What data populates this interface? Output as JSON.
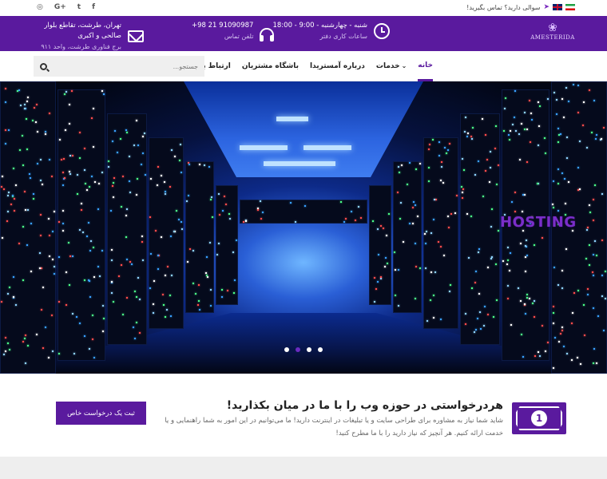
{
  "topbar": {
    "question": "سوالی دارید؟ تماس بگیرید!",
    "social": [
      "facebook",
      "twitter",
      "google-plus",
      "instagram"
    ],
    "social_glyphs": [
      "f",
      "t",
      "G+",
      "◎"
    ]
  },
  "header": {
    "logo_text": "AMESTERIDA",
    "hours": {
      "main": "شنبه - چهارشنبه - 9:00 - 18:00",
      "sub": "ساعات کاری دفتر"
    },
    "phone": {
      "main": "+98 21 91090987",
      "sub": "تلفن تماس"
    },
    "address": {
      "main": "تهران، طرشت، تقاطع بلوار صالحی و اکبری",
      "sub": "برج فناوری طرشت، واحد ۹۱۱"
    }
  },
  "nav": {
    "items": [
      {
        "label": "خانه",
        "active": true
      },
      {
        "label": "خدمات",
        "has_dropdown": true
      },
      {
        "label": "درباره آمستریدا"
      },
      {
        "label": "باشگاه مشتریان"
      },
      {
        "label": "ارتباط با ما"
      }
    ],
    "search_placeholder": "جستجو..."
  },
  "hero": {
    "caption": "HOSTING",
    "slides": 4,
    "active_slide": 2
  },
  "cta": {
    "title": "هردرخواستی در حوزه وب را با ما در میان بکذارید!",
    "text": "شاید شما نیاز به مشاوره برای طراحی سایت و یا تبلیغات در اینترنت دارید! ما می‌توانیم در این امور به شما راهنمایی و یا خدمت ارائه کنیم. هر آنچیز که نیاز دارید را با ما مطرح کنید!",
    "button": "ثبت یک درخواست خاص",
    "icon_digit": "1"
  },
  "colors": {
    "brand": "#5a1a9e",
    "accent_light": "#d4c2ef"
  }
}
